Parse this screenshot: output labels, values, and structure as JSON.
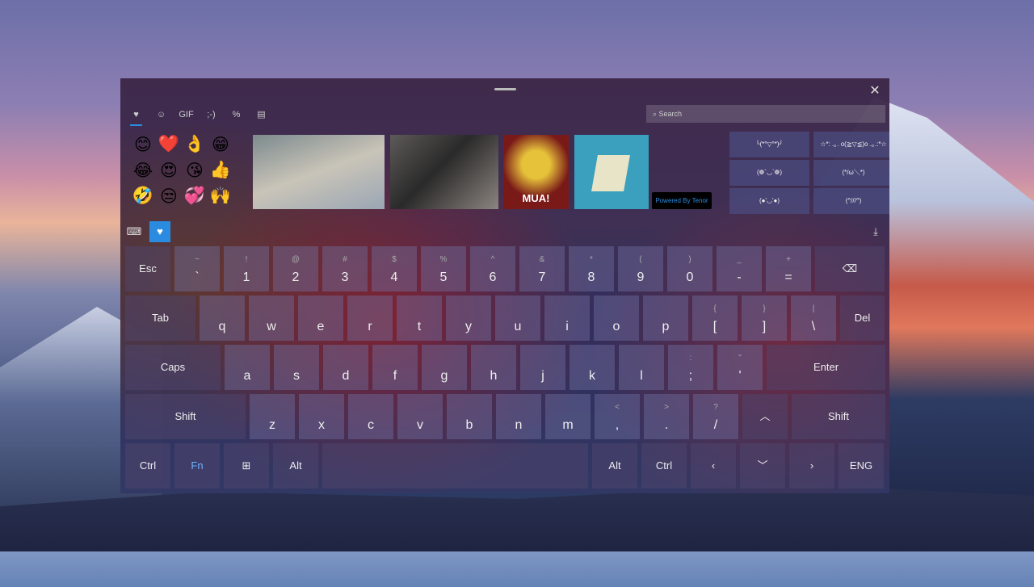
{
  "tabs": [
    {
      "icon": "favorites-icon",
      "glyph": "♥"
    },
    {
      "icon": "emoji-icon",
      "glyph": "☺"
    },
    {
      "icon": "gif-icon",
      "glyph": "GIF"
    },
    {
      "icon": "kaomoji-icon",
      "glyph": ";-)"
    },
    {
      "icon": "symbols-icon",
      "glyph": "%"
    },
    {
      "icon": "clipboard-icon",
      "glyph": "▤"
    }
  ],
  "search_placeholder": "Search",
  "emojis": [
    "😊",
    "❤️",
    "👌",
    "😁",
    "😂",
    "😍",
    "😘",
    "👍",
    "🤣",
    "😒",
    "💞",
    "🙌"
  ],
  "gifs": [
    {
      "caption": ""
    },
    {
      "caption": ""
    },
    {
      "caption": "MUA!"
    },
    {
      "caption": ""
    }
  ],
  "tenor_label": "Powered By Tenor",
  "kaomoji": [
    "╰(*°▽°*)╯",
    "☆*: .｡. o(≧▽≦)o .｡.:*☆",
    "(❁´◡`❁)",
    "(*/ω＼*)",
    "(●'◡'●)",
    "(^///^)"
  ],
  "accent": "#2b8be0",
  "rows": [
    [
      {
        "k": "Esc"
      },
      {
        "k": "`",
        "s": "~"
      },
      {
        "k": "1",
        "s": "!"
      },
      {
        "k": "2",
        "s": "@"
      },
      {
        "k": "3",
        "s": "#"
      },
      {
        "k": "4",
        "s": "$"
      },
      {
        "k": "5",
        "s": "%"
      },
      {
        "k": "6",
        "s": "^"
      },
      {
        "k": "7",
        "s": "&"
      },
      {
        "k": "8",
        "s": "*"
      },
      {
        "k": "9",
        "s": "("
      },
      {
        "k": "0",
        "s": ")"
      },
      {
        "k": "-",
        "s": "_"
      },
      {
        "k": "=",
        "s": "+"
      },
      {
        "k": "⌫"
      }
    ],
    [
      {
        "k": "Tab"
      },
      {
        "k": "q"
      },
      {
        "k": "w"
      },
      {
        "k": "e"
      },
      {
        "k": "r"
      },
      {
        "k": "t"
      },
      {
        "k": "y"
      },
      {
        "k": "u"
      },
      {
        "k": "i"
      },
      {
        "k": "o"
      },
      {
        "k": "p"
      },
      {
        "k": "[",
        "s": "{"
      },
      {
        "k": "]",
        "s": "}"
      },
      {
        "k": "\\",
        "s": "|"
      },
      {
        "k": "Del"
      }
    ],
    [
      {
        "k": "Caps"
      },
      {
        "k": "a"
      },
      {
        "k": "s"
      },
      {
        "k": "d"
      },
      {
        "k": "f"
      },
      {
        "k": "g"
      },
      {
        "k": "h"
      },
      {
        "k": "j"
      },
      {
        "k": "k"
      },
      {
        "k": "l"
      },
      {
        "k": ";",
        "s": ":"
      },
      {
        "k": "'",
        "s": "\""
      },
      {
        "k": "Enter"
      }
    ],
    [
      {
        "k": "Shift"
      },
      {
        "k": "z"
      },
      {
        "k": "x"
      },
      {
        "k": "c"
      },
      {
        "k": "v"
      },
      {
        "k": "b"
      },
      {
        "k": "n"
      },
      {
        "k": "m"
      },
      {
        "k": ",",
        "s": "<"
      },
      {
        "k": ".",
        "s": ">"
      },
      {
        "k": "/",
        "s": "?"
      },
      {
        "k": "︿"
      },
      {
        "k": "Shift"
      }
    ],
    [
      {
        "k": "Ctrl"
      },
      {
        "k": "Fn"
      },
      {
        "k": "⊞"
      },
      {
        "k": "Alt"
      },
      {
        "k": ""
      },
      {
        "k": "Alt"
      },
      {
        "k": "Ctrl"
      },
      {
        "k": "‹"
      },
      {
        "k": "﹀"
      },
      {
        "k": "›"
      },
      {
        "k": "ENG"
      }
    ]
  ]
}
